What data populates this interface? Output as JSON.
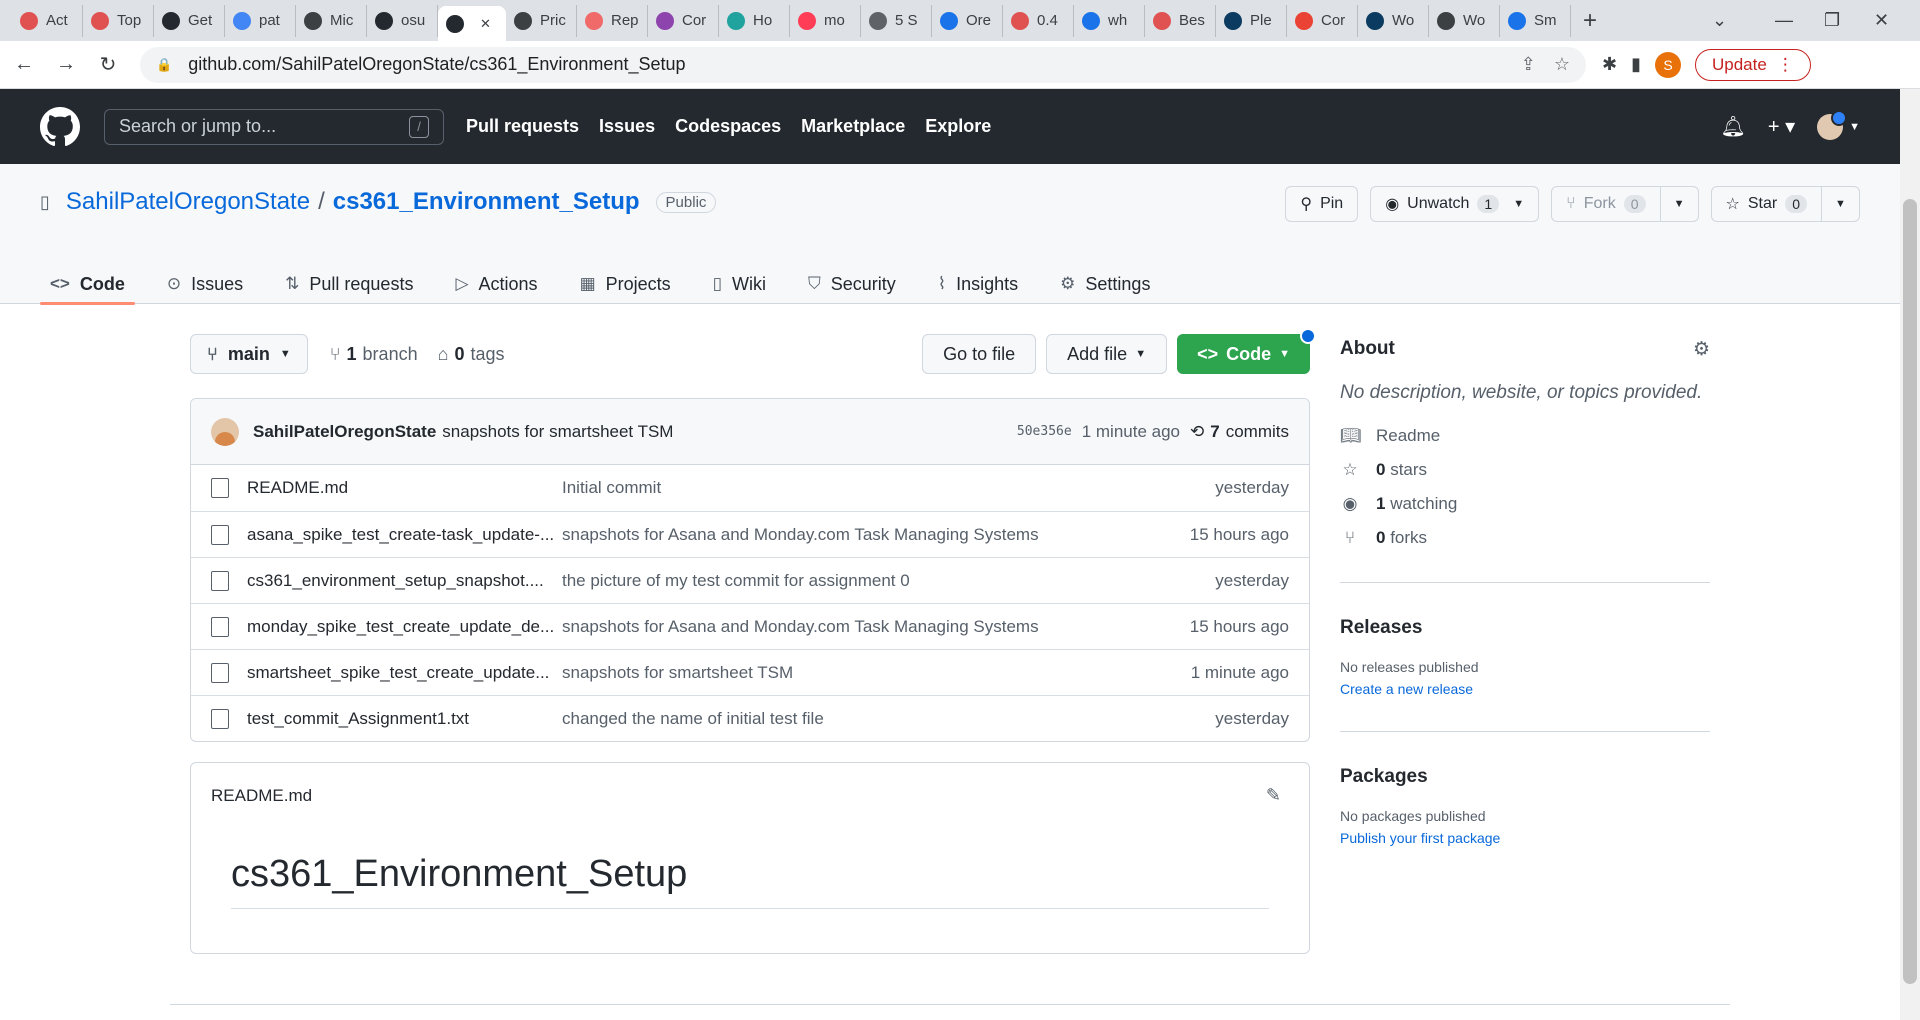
{
  "browser": {
    "tabs": [
      {
        "label": "Act",
        "color": "#e05252"
      },
      {
        "label": "Top",
        "color": "#e05252"
      },
      {
        "label": "Get",
        "color": "#24292f"
      },
      {
        "label": "pat",
        "color": "#4285f4"
      },
      {
        "label": "Mic",
        "color": "#3c4043"
      },
      {
        "label": "osu",
        "color": "#24292f"
      },
      {
        "label": "",
        "color": "#24292f"
      },
      {
        "label": "Pric",
        "color": "#3c4043"
      },
      {
        "label": "Rep",
        "color": "#f06a6a"
      },
      {
        "label": "Cor",
        "color": "#8e44ad"
      },
      {
        "label": "Ho",
        "color": "#20a39e"
      },
      {
        "label": "mo",
        "color": "#ff3d57"
      },
      {
        "label": "5 S",
        "color": "#5f6368"
      },
      {
        "label": "Ore",
        "color": "#1a73e8"
      },
      {
        "label": "0.4",
        "color": "#e05252"
      },
      {
        "label": "wh",
        "color": "#1a73e8"
      },
      {
        "label": "Bes",
        "color": "#e05252"
      },
      {
        "label": "Ple",
        "color": "#0b3b60"
      },
      {
        "label": "Cor",
        "color": "#ea4335"
      },
      {
        "label": "Wo",
        "color": "#0b3b60"
      },
      {
        "label": "Wo",
        "color": "#3c4043"
      },
      {
        "label": "Sm",
        "color": "#1a73e8"
      }
    ],
    "url": "github.com/SahilPatelOregonState/cs361_Environment_Setup",
    "profile_initial": "S",
    "update_label": "Update"
  },
  "gh": {
    "search_placeholder": "Search or jump to...",
    "slash": "/",
    "nav": [
      "Pull requests",
      "Issues",
      "Codespaces",
      "Marketplace",
      "Explore"
    ]
  },
  "repo": {
    "owner": "SahilPatelOregonState",
    "sep": "/",
    "name": "cs361_Environment_Setup",
    "visibility": "Public",
    "pin": "Pin",
    "unwatch": "Unwatch",
    "watch_count": "1",
    "fork": "Fork",
    "fork_count": "0",
    "star": "Star",
    "star_count": "0",
    "tabs": [
      "Code",
      "Issues",
      "Pull requests",
      "Actions",
      "Projects",
      "Wiki",
      "Security",
      "Insights",
      "Settings"
    ]
  },
  "toolbar": {
    "branch": "main",
    "branch_count": "1",
    "branch_word": "branch",
    "tag_count": "0",
    "tag_word": "tags",
    "go_to_file": "Go to file",
    "add_file": "Add file",
    "code": "Code"
  },
  "commit": {
    "author": "SahilPatelOregonState",
    "message": "snapshots for smartsheet TSM",
    "sha": "50e356e",
    "time": "1 minute ago",
    "count": "7",
    "count_word": "commits"
  },
  "files": [
    {
      "name": "README.md",
      "message": "Initial commit",
      "time": "yesterday"
    },
    {
      "name": "asana_spike_test_create-task_update-...",
      "message": "snapshots for Asana and Monday.com Task Managing Systems",
      "time": "15 hours ago"
    },
    {
      "name": "cs361_environment_setup_snapshot....",
      "message": "the picture of my test commit for assignment 0",
      "time": "yesterday"
    },
    {
      "name": "monday_spike_test_create_update_de...",
      "message": "snapshots for Asana and Monday.com Task Managing Systems",
      "time": "15 hours ago"
    },
    {
      "name": "smartsheet_spike_test_create_update...",
      "message": "snapshots for smartsheet TSM",
      "time": "1 minute ago"
    },
    {
      "name": "test_commit_Assignment1.txt",
      "message": "changed the name of initial test file",
      "time": "yesterday"
    }
  ],
  "readme": {
    "filename": "README.md",
    "heading": "cs361_Environment_Setup"
  },
  "about": {
    "title": "About",
    "description": "No description, website, or topics provided.",
    "readme": "Readme",
    "stars_count": "0",
    "stars_word": "stars",
    "watching_count": "1",
    "watching_word": "watching",
    "forks_count": "0",
    "forks_word": "forks"
  },
  "releases": {
    "title": "Releases",
    "none": "No releases published",
    "link": "Create a new release"
  },
  "packages": {
    "title": "Packages",
    "none": "No packages published",
    "link": "Publish your first package"
  }
}
